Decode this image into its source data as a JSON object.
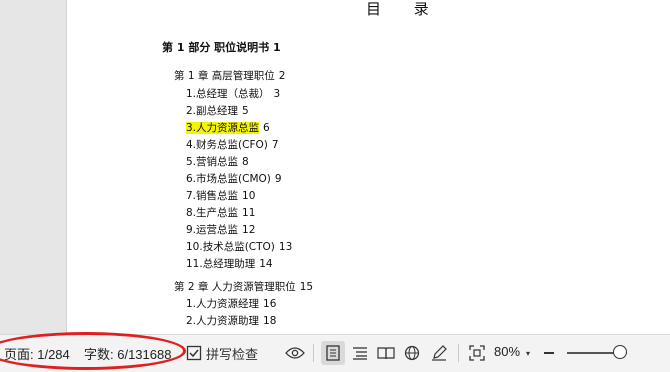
{
  "document": {
    "title": "目  录",
    "part": "第 1 部分  职位说明书  1",
    "chapters": [
      {
        "label": "第 1 章  高层管理职位",
        "page": "2",
        "entries": [
          {
            "label": "1.总经理（总裁）",
            "page": "3"
          },
          {
            "label": "2.副总经理",
            "page": "5"
          },
          {
            "label": "3.人力资源总监",
            "page": "6",
            "highlight": true
          },
          {
            "label": "4.财务总监(CFO)",
            "page": "7"
          },
          {
            "label": "5.营销总监",
            "page": "8"
          },
          {
            "label": "6.市场总监(CMO)",
            "page": "9"
          },
          {
            "label": "7.销售总监",
            "page": "10"
          },
          {
            "label": "8.生产总监",
            "page": "11"
          },
          {
            "label": "9.运营总监",
            "page": "12"
          },
          {
            "label": "10.技术总监(CTO)",
            "page": "13"
          },
          {
            "label": "11.总经理助理",
            "page": "14"
          }
        ]
      },
      {
        "label": "第 2 章  人力资源管理职位",
        "page": "15",
        "entries": [
          {
            "label": "1.人力资源经理",
            "page": "16"
          },
          {
            "label": "2.人力资源助理",
            "page": "18"
          }
        ]
      }
    ]
  },
  "status_bar": {
    "page_indicator": "页面: 1/284",
    "word_count": "字数: 6/131688",
    "spell_check_label": "拼写检查",
    "zoom_level": "80%",
    "zoom_fraction": 0.8,
    "icons": [
      "spellcheck-icon",
      "eye-icon",
      "page-view-icon",
      "outline-view-icon",
      "reading-view-icon",
      "web-view-icon",
      "pen-icon",
      "fit-icon",
      "zoom-dropdown-icon",
      "zoom-out-icon"
    ],
    "highlight_color": "#f5f500",
    "annotation_color": "#e02020"
  }
}
